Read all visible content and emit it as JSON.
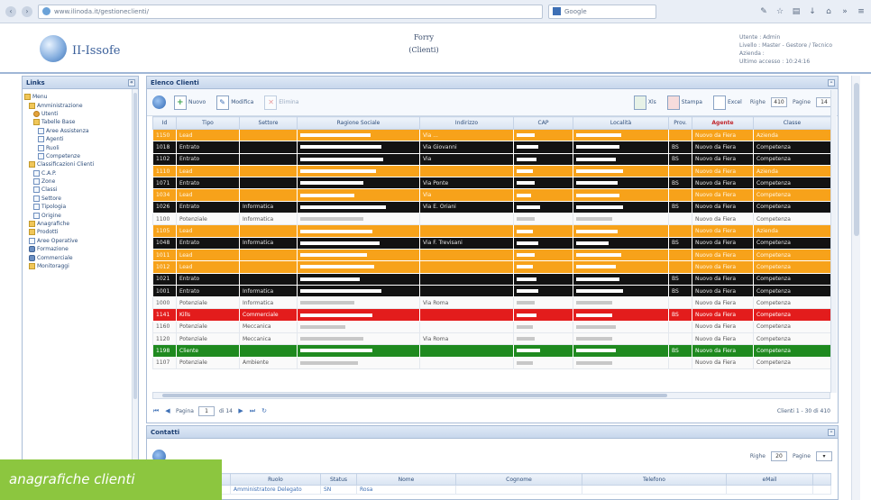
{
  "browser": {
    "url": "www.ilinoda.it/gestioneclienti/",
    "search_placeholder": "Google"
  },
  "header": {
    "logo_text": "II-Issofe",
    "center_line1": "Forry",
    "center_line2": "(Clienti)",
    "user_line1": "Utente : Admin",
    "user_line2": "Livello : Master - Gestore / Tecnico",
    "user_line3": "Azienda :",
    "user_line4": "Ultimo accesso : 10:24:16"
  },
  "sidebar": {
    "title": "Links",
    "items": [
      {
        "label": "Menu",
        "icon": "folder-icon",
        "indent": 0
      },
      {
        "label": "Amministrazione",
        "icon": "folder-icon",
        "indent": 1
      },
      {
        "label": "Utenti",
        "icon": "user-icon",
        "indent": 2
      },
      {
        "label": "Tabelle Base",
        "icon": "folder-icon",
        "indent": 2
      },
      {
        "label": "Aree Assistenza",
        "icon": "page-icon",
        "indent": 3
      },
      {
        "label": "Agenti",
        "icon": "page-icon",
        "indent": 3
      },
      {
        "label": "Ruoli",
        "icon": "page-icon",
        "indent": 3
      },
      {
        "label": "Competenze",
        "icon": "page-icon",
        "indent": 3
      },
      {
        "label": "Classificazioni Clienti",
        "icon": "folder-icon",
        "indent": 1
      },
      {
        "label": "C.A.P.",
        "icon": "page-icon",
        "indent": 2
      },
      {
        "label": "Zone",
        "icon": "page-icon",
        "indent": 2
      },
      {
        "label": "Classi",
        "icon": "page-icon",
        "indent": 2
      },
      {
        "label": "Settore",
        "icon": "page-icon",
        "indent": 2
      },
      {
        "label": "Tipologia",
        "icon": "page-icon",
        "indent": 2
      },
      {
        "label": "Origine",
        "icon": "page-icon",
        "indent": 2
      },
      {
        "label": "Anagrafiche",
        "icon": "folder-icon",
        "indent": 1
      },
      {
        "label": "Prodotti",
        "icon": "folder-icon",
        "indent": 1
      },
      {
        "label": "Aree Operative",
        "icon": "page-icon",
        "indent": 1
      },
      {
        "label": "Formazione",
        "icon": "gear-icon",
        "indent": 1
      },
      {
        "label": "Commerciale",
        "icon": "gear-icon",
        "indent": 1
      },
      {
        "label": "Monitoraggi",
        "icon": "folder-icon",
        "indent": 1
      }
    ]
  },
  "grid_panel": {
    "title": "Elenco Clienti",
    "toolbar": {
      "add_label": "Nuovo",
      "edit_label": "Modifica",
      "delete_label": "Elimina",
      "xls_label": "Xls",
      "pdf_label": "Stampa",
      "excel_label": "Excel",
      "righe_label": "Righe",
      "righe_value": "410",
      "pagine_label": "Pagine",
      "pagine_value": "14"
    },
    "columns": [
      "Id",
      "Tipo",
      "Settore",
      "Ragione Sociale",
      "Indirizzo",
      "CAP",
      "Località",
      "Prov.",
      "Agente",
      "Classe"
    ],
    "rows": [
      {
        "style": "orange",
        "id": "1150",
        "tipo": "Lead",
        "settore": "",
        "ragione": 78,
        "indirizzo": "Via ...",
        "cap": 20,
        "localita": 50,
        "prov": "",
        "agente": "Nuovo da Fiera",
        "classe": "Azienda"
      },
      {
        "style": "black",
        "id": "1018",
        "tipo": "Entrato",
        "settore": "",
        "ragione": 90,
        "indirizzo": "Via Giovanni",
        "cap": 24,
        "localita": 48,
        "prov": "BS",
        "agente": "Nuovo da Fiera",
        "classe": "Competenza"
      },
      {
        "style": "black",
        "id": "1102",
        "tipo": "Entrato",
        "settore": "",
        "ragione": 92,
        "indirizzo": "Via",
        "cap": 22,
        "localita": 44,
        "prov": "BS",
        "agente": "Nuovo da Fiera",
        "classe": "Competenza"
      },
      {
        "style": "orange",
        "id": "1110",
        "tipo": "Lead",
        "settore": "",
        "ragione": 84,
        "indirizzo": "",
        "cap": 18,
        "localita": 52,
        "prov": "",
        "agente": "Nuovo da Fiera",
        "classe": "Azienda"
      },
      {
        "style": "black",
        "id": "1071",
        "tipo": "Entrato",
        "settore": "",
        "ragione": 70,
        "indirizzo": "Via Ponte",
        "cap": 20,
        "localita": 46,
        "prov": "BS",
        "agente": "Nuovo da Fiera",
        "classe": "Competenza"
      },
      {
        "style": "orange",
        "id": "1034",
        "tipo": "Lead",
        "settore": "",
        "ragione": 60,
        "indirizzo": "Via",
        "cap": 16,
        "localita": 48,
        "prov": "",
        "agente": "Nuovo da Fiera",
        "classe": "Competenza"
      },
      {
        "style": "black",
        "id": "1026",
        "tipo": "Entrato",
        "settore": "Informatica",
        "ragione": 95,
        "indirizzo": "Via E. Oriani",
        "cap": 26,
        "localita": 52,
        "prov": "BS",
        "agente": "Nuovo da Fiera",
        "classe": "Competenza"
      },
      {
        "style": "white",
        "id": "1100",
        "tipo": "Potenziale",
        "settore": "Informatica",
        "ragione": 70,
        "indirizzo": "",
        "cap": 20,
        "localita": 40,
        "prov": "",
        "agente": "Nuovo da Fiera",
        "classe": "Competenza"
      },
      {
        "style": "orange",
        "id": "1105",
        "tipo": "Lead",
        "settore": "",
        "ragione": 80,
        "indirizzo": "",
        "cap": 18,
        "localita": 46,
        "prov": "",
        "agente": "Nuovo da Fiera",
        "classe": "Azienda"
      },
      {
        "style": "black",
        "id": "1048",
        "tipo": "Entrato",
        "settore": "Informatica",
        "ragione": 88,
        "indirizzo": "Via F. Trevisani",
        "cap": 24,
        "localita": 36,
        "prov": "BS",
        "agente": "Nuovo da Fiera",
        "classe": "Competenza"
      },
      {
        "style": "orange",
        "id": "1011",
        "tipo": "Lead",
        "settore": "",
        "ragione": 74,
        "indirizzo": "",
        "cap": 20,
        "localita": 50,
        "prov": "",
        "agente": "Nuovo da Fiera",
        "classe": "Competenza"
      },
      {
        "style": "orange",
        "id": "1012",
        "tipo": "Lead",
        "settore": "",
        "ragione": 82,
        "indirizzo": "",
        "cap": 18,
        "localita": 44,
        "prov": "",
        "agente": "Nuovo da Fiera",
        "classe": "Competenza"
      },
      {
        "style": "black",
        "id": "1021",
        "tipo": "Entrato",
        "settore": "",
        "ragione": 66,
        "indirizzo": "",
        "cap": 22,
        "localita": 48,
        "prov": "BS",
        "agente": "Nuovo da Fiera",
        "classe": "Competenza"
      },
      {
        "style": "black",
        "id": "1001",
        "tipo": "Entrato",
        "settore": "Informatica",
        "ragione": 90,
        "indirizzo": "",
        "cap": 24,
        "localita": 52,
        "prov": "BS",
        "agente": "Nuovo da Fiera",
        "classe": "Competenza"
      },
      {
        "style": "white",
        "id": "1000",
        "tipo": "Potenziale",
        "settore": "Informatica",
        "ragione": 60,
        "indirizzo": "Via Roma",
        "cap": 20,
        "localita": 40,
        "prov": "",
        "agente": "Nuovo da Fiera",
        "classe": "Competenza"
      },
      {
        "style": "red",
        "id": "1141",
        "tipo": "Kills",
        "settore": "Commerciale",
        "ragione": 80,
        "indirizzo": "",
        "cap": 22,
        "localita": 40,
        "prov": "BS",
        "agente": "Nuovo da Fiera",
        "classe": "Competenza"
      },
      {
        "style": "white",
        "id": "1160",
        "tipo": "Potenziale",
        "settore": "Meccanica",
        "ragione": 50,
        "indirizzo": "",
        "cap": 18,
        "localita": 44,
        "prov": "",
        "agente": "Nuovo da Fiera",
        "classe": "Competenza"
      },
      {
        "style": "white",
        "id": "1120",
        "tipo": "Potenziale",
        "settore": "Meccanica",
        "ragione": 70,
        "indirizzo": "Via Roma",
        "cap": 20,
        "localita": 40,
        "prov": "",
        "agente": "Nuovo da Fiera",
        "classe": "Competenza"
      },
      {
        "style": "green",
        "id": "1198",
        "tipo": "Cliente",
        "settore": "",
        "ragione": 80,
        "indirizzo": "",
        "cap": 26,
        "localita": 44,
        "prov": "BS",
        "agente": "Nuovo da Fiera",
        "classe": "Competenza"
      },
      {
        "style": "white",
        "id": "1107",
        "tipo": "Potenziale",
        "settore": "Ambiente",
        "ragione": 64,
        "indirizzo": "",
        "cap": 18,
        "localita": 40,
        "prov": "",
        "agente": "Nuovo da Fiera",
        "classe": "Competenza"
      }
    ],
    "pager": {
      "page_label": "Pagina",
      "page_value": "1",
      "of_label": "di 14",
      "info": "Clienti 1 - 30 di 410"
    }
  },
  "contacts_panel": {
    "title": "Contatti",
    "righe_label": "Righe",
    "righe_value": "20",
    "pagine_label": "Pagine",
    "columns": [
      "",
      "Ruolo",
      "Status",
      "Nome",
      "Cognome",
      "Telefono",
      "eMail",
      ""
    ],
    "rows": [
      {
        "ruolo": "Amministratore Delegato",
        "status": "SN",
        "nome": "Rosa",
        "cognome": "",
        "telefono": "",
        "email": ""
      }
    ]
  },
  "caption": "anagrafiche clienti",
  "colors": {
    "orange_row": "#f7a21a",
    "black_row": "#121212",
    "red_row": "#e31c1c",
    "green_row": "#1f8a1f",
    "caption_bg": "#8cc63f",
    "panel_border": "#a9bcd6"
  }
}
